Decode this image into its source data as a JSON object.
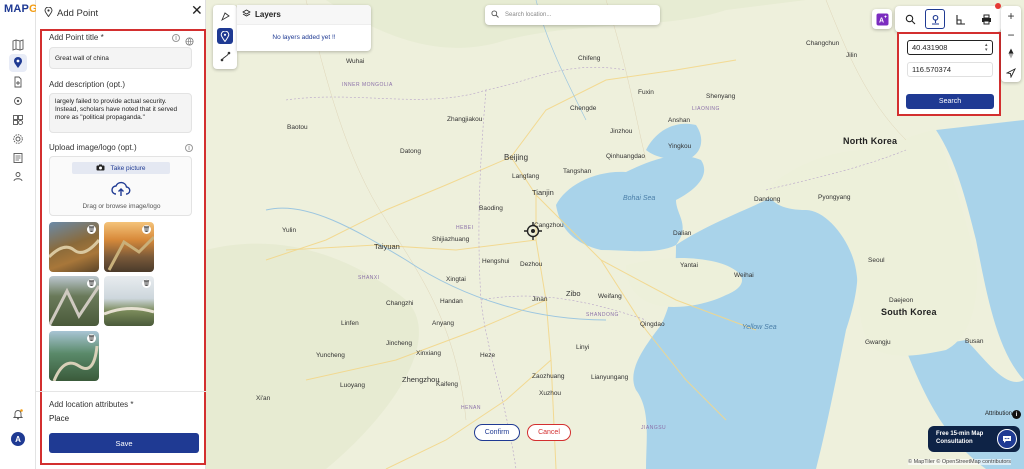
{
  "app": {
    "logo_prefix": "MAP",
    "logo_suffix": "G"
  },
  "panel": {
    "title": "Add Point",
    "point_title_label": "Add Point title *",
    "point_title_value": "Great wall of china",
    "description_label": "Add description (opt.)",
    "description_value": "largely failed to provide actual security. Instead, scholars have noted that it served more as \"political propaganda.\"",
    "upload_label": "Upload image/logo (opt.)",
    "take_picture": "Take picture",
    "drag_browse": "Drag or browse image/logo",
    "attributes_label": "Add location attributes *",
    "attributes_value": "Place",
    "save": "Save"
  },
  "layers": {
    "title": "Layers",
    "empty": "No layers added yet !!"
  },
  "search": {
    "placeholder": "Search location..."
  },
  "coords": {
    "lat": "40.431908",
    "lng": "116.570374",
    "search": "Search"
  },
  "map": {
    "labels": [
      {
        "name": "Beijing",
        "cls": ""
      },
      {
        "name": "Tianjin",
        "cls": ""
      },
      {
        "name": "Shijiazhuang",
        "cls": ""
      },
      {
        "name": "Taiyuan",
        "cls": ""
      },
      {
        "name": "Jinan",
        "cls": ""
      },
      {
        "name": "Zibo",
        "cls": ""
      },
      {
        "name": "Qingdao",
        "cls": ""
      },
      {
        "name": "Zhengzhou",
        "cls": ""
      },
      {
        "name": "Xi'an",
        "cls": ""
      },
      {
        "name": "Baotou",
        "cls": ""
      },
      {
        "name": "Datong",
        "cls": ""
      },
      {
        "name": "Zhangjiakou",
        "cls": ""
      },
      {
        "name": "Chengde",
        "cls": ""
      },
      {
        "name": "Qinhuangdao",
        "cls": ""
      },
      {
        "name": "Tangshan",
        "cls": ""
      },
      {
        "name": "Langfang",
        "cls": ""
      },
      {
        "name": "Baoding",
        "cls": ""
      },
      {
        "name": "Handan",
        "cls": ""
      },
      {
        "name": "Linfen",
        "cls": ""
      },
      {
        "name": "Weifang",
        "cls": ""
      },
      {
        "name": "Linyi",
        "cls": ""
      },
      {
        "name": "Xuzhou",
        "cls": ""
      },
      {
        "name": "Yulin",
        "cls": ""
      },
      {
        "name": "Dalian",
        "cls": ""
      },
      {
        "name": "Shenyang",
        "cls": ""
      },
      {
        "name": "Dandong",
        "cls": ""
      },
      {
        "name": "Yantai",
        "cls": ""
      },
      {
        "name": "Weihai",
        "cls": ""
      },
      {
        "name": "Luoyang",
        "cls": ""
      },
      {
        "name": "Kaifeng",
        "cls": ""
      },
      {
        "name": "Heze",
        "cls": ""
      },
      {
        "name": "Zaozhuang",
        "cls": ""
      },
      {
        "name": "Lianyungang",
        "cls": ""
      },
      {
        "name": "Anshan",
        "cls": ""
      },
      {
        "name": "Yingkou",
        "cls": ""
      },
      {
        "name": "Jinzhou",
        "cls": ""
      },
      {
        "name": "North Korea",
        "cls": "big"
      },
      {
        "name": "South Korea",
        "cls": "big"
      },
      {
        "name": "Pyongyang",
        "cls": ""
      },
      {
        "name": "Seoul",
        "cls": ""
      },
      {
        "name": "Daejeon",
        "cls": ""
      },
      {
        "name": "Busan",
        "cls": ""
      },
      {
        "name": "Gwangju",
        "cls": ""
      },
      {
        "name": "Bohai Sea",
        "cls": "sea"
      },
      {
        "name": "Yellow Sea",
        "cls": "sea"
      },
      {
        "name": "INNER MONGOLIA",
        "cls": "prov"
      },
      {
        "name": "HEBEI",
        "cls": "prov"
      },
      {
        "name": "SHANXI",
        "cls": "prov"
      },
      {
        "name": "SHANDONG",
        "cls": "prov"
      },
      {
        "name": "HENAN",
        "cls": "prov"
      },
      {
        "name": "LIAONING",
        "cls": "prov"
      },
      {
        "name": "JIANGSU",
        "cls": "prov"
      },
      {
        "name": "Wuhai",
        "cls": ""
      },
      {
        "name": "Chifeng",
        "cls": ""
      },
      {
        "name": "Fuxin",
        "cls": ""
      },
      {
        "name": "Changchun",
        "cls": ""
      },
      {
        "name": "Jilin",
        "cls": ""
      },
      {
        "name": "Cangzhou",
        "cls": ""
      },
      {
        "name": "Dezhou",
        "cls": ""
      },
      {
        "name": "Hengshui",
        "cls": ""
      },
      {
        "name": "Xingtai",
        "cls": ""
      },
      {
        "name": "Changzhi",
        "cls": ""
      },
      {
        "name": "Jincheng",
        "cls": ""
      },
      {
        "name": "Xinxiang",
        "cls": ""
      },
      {
        "name": "Anyang",
        "cls": ""
      },
      {
        "name": "Yuncheng",
        "cls": ""
      }
    ],
    "confirm": "Confirm",
    "cancel": "Cancel",
    "attribution": "Attribution",
    "attribution_i": "i",
    "copyright": "© MapTiler © OpenStreetMap contributors",
    "consult_line1": "Free 15-min Map",
    "consult_line2": "Consultation",
    "avatar": "A"
  },
  "colors": {
    "brand": "#1f3a93",
    "accent": "#d32f2f",
    "sea": "#a9d3ea",
    "land": "#eef0e6"
  }
}
